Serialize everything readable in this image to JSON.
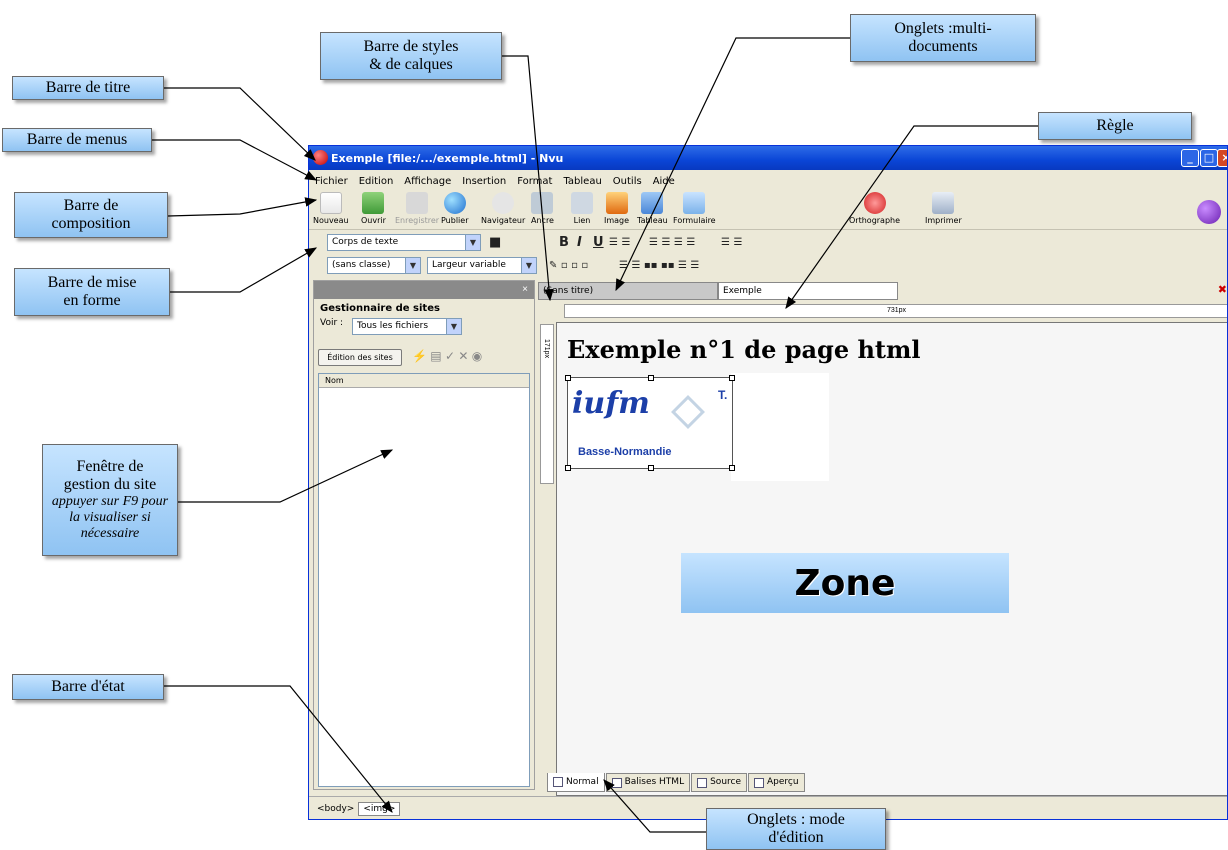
{
  "window": {
    "title": "Exemple [file:/.../exemple.html] - Nvu"
  },
  "menu": [
    "Fichier",
    "Edition",
    "Affichage",
    "Insertion",
    "Format",
    "Tableau",
    "Outils",
    "Aide"
  ],
  "toolbar": {
    "items": [
      "Nouveau",
      "Ouvrir",
      "Enregistrer",
      "Publier",
      "Navigateur",
      "Ancre",
      "Lien",
      "Image",
      "Tableau",
      "Formulaire",
      "Orthographe",
      "Imprimer"
    ]
  },
  "format": {
    "paragraph": "Corps de texte",
    "class": "(sans classe)",
    "width": "Largeur variable"
  },
  "site_manager": {
    "title": "Gestionnaire de sites",
    "close": "×",
    "voir_label": "Voir :",
    "filter": "Tous les fichiers",
    "edit_button": "Édition des sites",
    "column": "Nom"
  },
  "editor": {
    "tabs": [
      "(Sans titre)",
      "Exemple"
    ],
    "ruler_label": "731px",
    "vruler_label": "171px",
    "page_title": "Exemple n°1 de page html",
    "image_text": {
      "logo": "iufm",
      "region": "Basse-Normandie",
      "fragment": "T."
    },
    "zone_label": "Zone",
    "mode_tabs": [
      "Normal",
      "Balises HTML",
      "Source",
      "Aperçu"
    ]
  },
  "status": {
    "tags": [
      "<body>",
      "<img>"
    ]
  },
  "callouts": {
    "titre": "Barre de titre",
    "menus": "Barre de menus",
    "composition": [
      "Barre de",
      "composition"
    ],
    "mise_en_forme": [
      "Barre de mise",
      "en forme"
    ],
    "styles": [
      "Barre de styles",
      "& de calques"
    ],
    "onglets_multi": [
      "Onglets :multi-",
      "documents"
    ],
    "regle": "Règle",
    "fenetre": [
      "Fenêtre de",
      "gestion du site"
    ],
    "fenetre_note": [
      "appuyer sur F9 pour",
      "la visualiser si",
      "nécessaire"
    ],
    "etat": "Barre d'état",
    "onglets_mode": [
      "Onglets : mode",
      "d'édition"
    ]
  }
}
